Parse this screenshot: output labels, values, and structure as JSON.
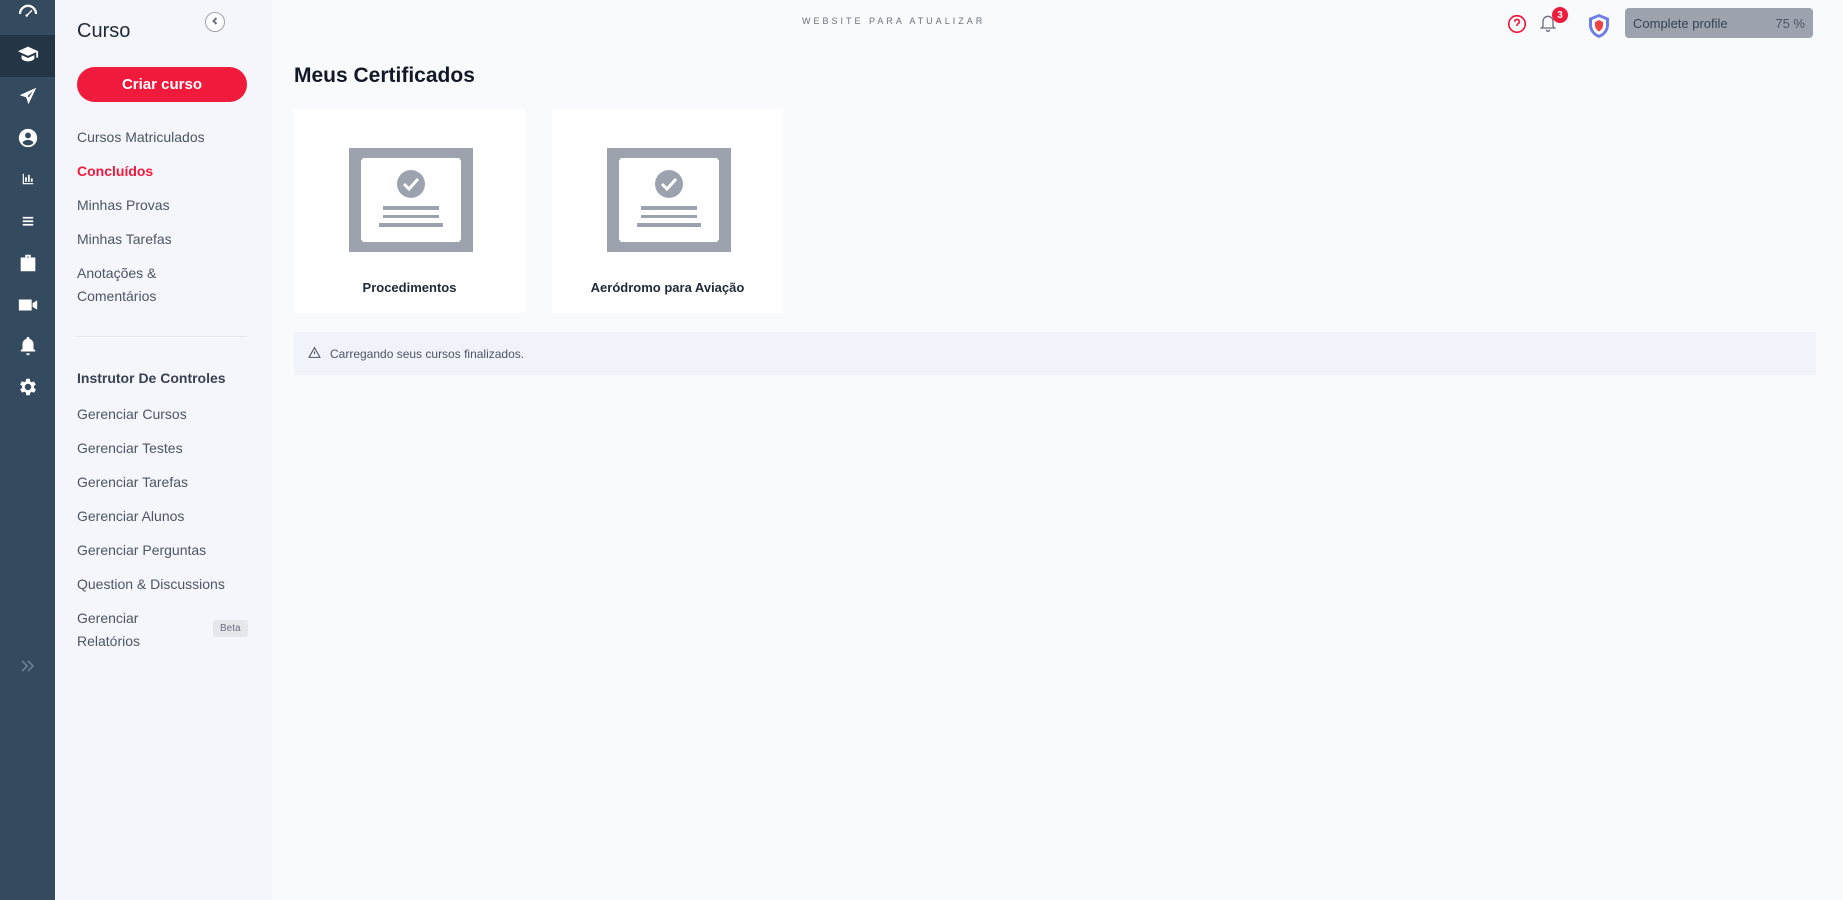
{
  "topbar": {
    "center_link": "Website para Atualizar",
    "notification_count": "3",
    "profile_label": "Complete profile",
    "profile_progress": "75 %"
  },
  "submenu": {
    "title": "Curso",
    "create_button": "Criar curso",
    "links": [
      {
        "label": "Cursos Matriculados",
        "active": false
      },
      {
        "label": "Concluídos",
        "active": true
      },
      {
        "label": "Minhas Provas",
        "active": false
      },
      {
        "label": "Minhas Tarefas",
        "active": false
      },
      {
        "label": "Anotações & Comentários",
        "active": false
      }
    ],
    "section_title": "Instrutor De Controles",
    "manage_links": [
      "Gerenciar Cursos",
      "Gerenciar Testes",
      "Gerenciar Tarefas",
      "Gerenciar Alunos",
      "Gerenciar Perguntas",
      "Question & Discussions",
      "Gerenciar Relatórios"
    ],
    "beta_badge": "Beta"
  },
  "main": {
    "title": "Meus Certificados",
    "certificates": [
      {
        "name": "Procedimentos"
      },
      {
        "name": "Aeródromo para Aviação"
      }
    ],
    "notice": "Carregando seus cursos finalizados."
  },
  "rail_icons": [
    "dashboard-icon",
    "graduation-cap-icon",
    "paper-plane-icon",
    "user-circle-icon",
    "chart-icon",
    "list-icon",
    "briefcase-icon",
    "video-camera-icon",
    "bell-icon",
    "gear-icon",
    "expand-chevrons-icon"
  ]
}
